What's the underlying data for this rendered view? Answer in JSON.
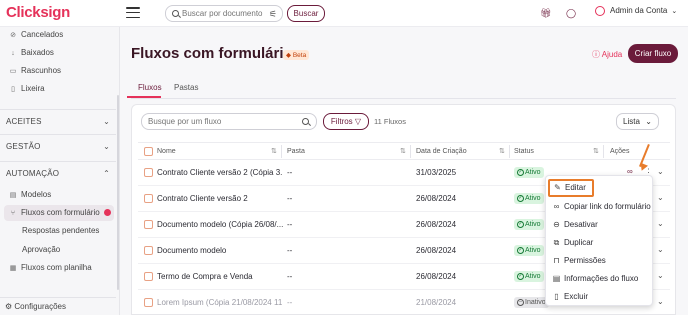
{
  "topbar": {
    "logo": "Clicksign",
    "search_placeholder": "Buscar por documento",
    "search_button": "Buscar",
    "user": "Admin da Conta"
  },
  "sidebar": {
    "items_top": [
      {
        "label": "Cancelados",
        "icon": "cancel-icon"
      },
      {
        "label": "Baixados",
        "icon": "download-icon"
      },
      {
        "label": "Rascunhos",
        "icon": "draft-icon"
      },
      {
        "label": "Lixeira",
        "icon": "trash-icon"
      }
    ],
    "sections": [
      {
        "label": "ACEITES"
      },
      {
        "label": "GESTÃO"
      },
      {
        "label": "AUTOMAÇÃO"
      }
    ],
    "automation_items": [
      {
        "label": "Modelos"
      },
      {
        "label": "Fluxos com formulário"
      },
      {
        "label": "Respostas pendentes"
      },
      {
        "label": "Aprovação"
      },
      {
        "label": "Fluxos com planilha"
      }
    ],
    "config": "Configurações"
  },
  "main": {
    "title": "Fluxos com formulário",
    "beta": "Beta",
    "help": "Ajuda",
    "create_button": "Criar fluxo",
    "tabs": [
      {
        "label": "Fluxos"
      },
      {
        "label": "Pastas"
      }
    ],
    "search_placeholder": "Busque por um fluxo",
    "filters_button": "Filtros",
    "count": "11 Fluxos",
    "view": "Lista"
  },
  "table": {
    "headers": {
      "name": "Nome",
      "folder": "Pasta",
      "created": "Data de Criação",
      "status": "Status",
      "actions": "Ações"
    },
    "rows": [
      {
        "name": "Contrato Cliente versão 2 (Cópia 3...",
        "folder": "--",
        "created": "31/03/2025",
        "status": "Ativo"
      },
      {
        "name": "Contrato Cliente versão 2",
        "folder": "--",
        "created": "26/08/2024",
        "status": "Ativo"
      },
      {
        "name": "Documento modelo (Cópia 26/08/...",
        "folder": "--",
        "created": "26/08/2024",
        "status": "Ativo"
      },
      {
        "name": "Documento modelo",
        "folder": "--",
        "created": "26/08/2024",
        "status": "Ativo"
      },
      {
        "name": "Termo de Compra e Venda",
        "folder": "--",
        "created": "26/08/2024",
        "status": "Ativo"
      },
      {
        "name": "Lorem Ipsum (Cópia 21/08/2024 11...",
        "folder": "--",
        "created": "21/08/2024",
        "status": "Inativo"
      }
    ]
  },
  "menu": {
    "items": [
      {
        "label": "Editar",
        "icon": "pencil-icon"
      },
      {
        "label": "Copiar link do formulário",
        "icon": "link-icon"
      },
      {
        "label": "Desativar",
        "icon": "disable-icon"
      },
      {
        "label": "Duplicar",
        "icon": "duplicate-icon"
      },
      {
        "label": "Permissões",
        "icon": "lock-icon"
      },
      {
        "label": "Informações do fluxo",
        "icon": "info-icon"
      },
      {
        "label": "Excluir",
        "icon": "trash-icon"
      }
    ]
  },
  "colors": {
    "brand": "#e5325a",
    "primary": "#6b1b3b",
    "highlight": "#e87c2b",
    "active_status": "#157a35"
  }
}
